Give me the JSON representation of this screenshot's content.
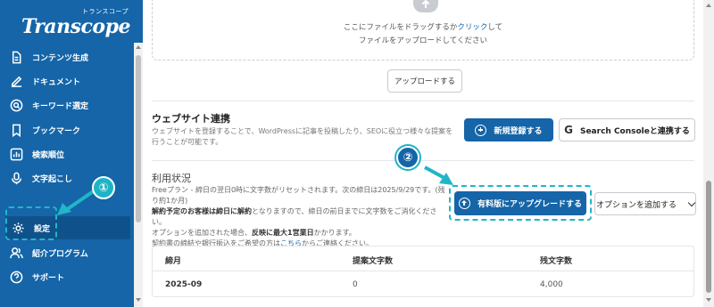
{
  "colors": {
    "sidebar": "#1565a8",
    "accent": "#1565a8",
    "annotation": "#20b6c8"
  },
  "sidebar": {
    "logo_small": "トランスコープ",
    "logo_main": "Transcope",
    "items": [
      {
        "label": "コンテンツ生成",
        "icon": "file-icon"
      },
      {
        "label": "ドキュメント",
        "icon": "edit-icon"
      },
      {
        "label": "キーワード選定",
        "icon": "search-icon"
      },
      {
        "label": "ブックマーク",
        "icon": "bookmark-icon"
      },
      {
        "label": "検索順位",
        "icon": "chart-icon"
      },
      {
        "label": "文字起こし",
        "icon": "mic-icon"
      },
      {
        "label": "設定",
        "icon": "gear-icon"
      },
      {
        "label": "紹介プログラム",
        "icon": "users-icon"
      },
      {
        "label": "サポート",
        "icon": "help-icon"
      }
    ]
  },
  "upload": {
    "text_pre": "ここにファイルをドラッグするか",
    "text_link": "クリック",
    "text_post": "して",
    "text_line2": "ファイルをアップロードしてください",
    "button": "アップロードする"
  },
  "website": {
    "title": "ウェブサイト連携",
    "desc": "ウェブサイトを登録することで、WordPressに記事を投稿したり、SEOに役立つ様々な提案を行うことが可能です。",
    "new_button": "新規登録する",
    "gsc_button": "Search Consoleと連携する"
  },
  "usage": {
    "title": "利用状況",
    "line1": "Freeプラン - 締日の翌日0時に文字数がリセットされます。次の締日は2025/9/29です。(残り約1か月)",
    "line2_bold_a": "解約予定のお客様は締日に解約",
    "line2_rest": "となりますので、締日の前日までに文字数をご消化ください。",
    "line3_a": "オプションを追加された場合、",
    "line3_bold": "反映に最大1営業日",
    "line3_b": "かかります。",
    "line4_a": "契約書の締結や銀行振込をご希望の方は",
    "line4_link": "こちら",
    "line4_b": "からご連絡ください。",
    "upgrade_button": "有料版にアップグレードする",
    "option_button": "オプションを追加する"
  },
  "table": {
    "headers": [
      "締月",
      "提案文字数",
      "残文字数"
    ],
    "rows": [
      [
        "2025-09",
        "0",
        "4,000"
      ]
    ]
  },
  "annotations": {
    "one": "①",
    "two": "②"
  }
}
